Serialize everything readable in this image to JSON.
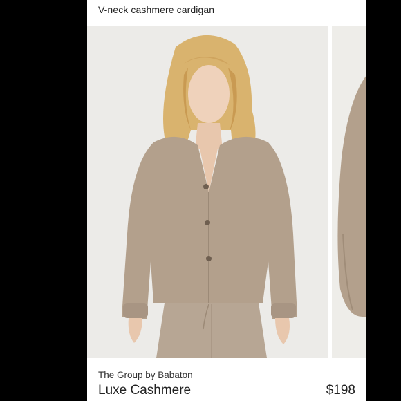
{
  "listing": {
    "subtitle": "V-neck cashmere cardigan",
    "brand": "The Group by Babaton",
    "name": "Luxe Cashmere",
    "price": "$198"
  },
  "colors": {
    "background": "#000000",
    "panel": "#ffffff",
    "photo_backdrop": "#ecebe8",
    "cardigan": "#b3a08c",
    "hair": "#d9b36e"
  }
}
